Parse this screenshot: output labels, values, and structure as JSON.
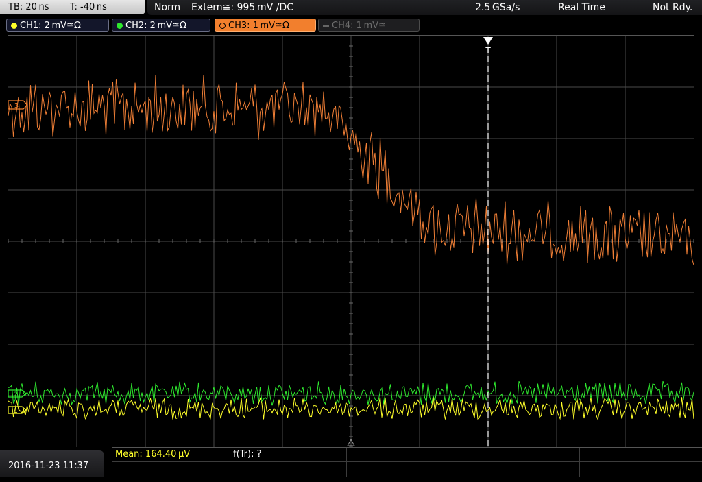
{
  "status": {
    "timebase": "TB: 20 ns",
    "trigger_offset": "T: -40 ns",
    "trigger_mode": "Norm",
    "trigger_source": "Extern≅: 995 mV ∕DC",
    "sample_rate": "2.5 GSa/s",
    "acq_mode": "Real Time",
    "run_state": "Not Rdy."
  },
  "channels": [
    {
      "label": "CH1: 2 mV≅Ω",
      "color": "#ffff2a",
      "active": true
    },
    {
      "label": "CH2: 2 mV≅Ω",
      "color": "#2ee82e",
      "active": true
    },
    {
      "label": "CH3: 1 mV≅Ω",
      "color": "#f27f2d",
      "active": true
    },
    {
      "label": "CH4: 1 mV≅",
      "color": "#6d6d6d",
      "active": false
    }
  ],
  "markers": {
    "ch3": "3",
    "ch2": "2",
    "ch1": "1",
    "trigger": "T"
  },
  "colors": {
    "grid": "#4a4a4a",
    "ch1": "#ffff2a",
    "ch2": "#2ee82e",
    "ch3": "#f07f36"
  },
  "footer": {
    "datetime": "2016-11-23 11:37",
    "meas1_label": "Mean: 164.40 µV",
    "meas1_color": "#ffff2a",
    "meas2_label": "f(Tr): ?"
  }
}
